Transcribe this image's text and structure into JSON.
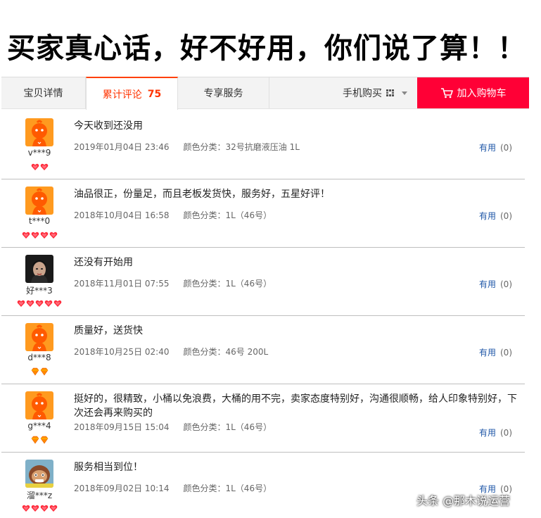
{
  "headline": "买家真心话，好不好用，你们说了算！！",
  "tabs": {
    "detail": "宝贝详情",
    "reviews_label": "累计评论",
    "reviews_count": "75",
    "service": "专享服务",
    "mobile_buy": "手机购买",
    "add_to_cart": "加入购物车"
  },
  "colors": {
    "accent": "#ff0036",
    "tab_active": "#ff3300",
    "link": "#1e56a7"
  },
  "useful_label": "有用",
  "spec_prefix": "颜色分类：",
  "reviews": [
    {
      "user": "v***9",
      "avatar": "tmall-default-avatar",
      "badge_count": 2,
      "badge_type": "red-heart",
      "content": "今天收到还没用",
      "date": "2019年01月04日 23:46",
      "spec": "颜色分类：32号抗磨液压油 1L",
      "useful": "(0)"
    },
    {
      "user": "t***0",
      "avatar": "tmall-default-avatar",
      "badge_count": 4,
      "badge_type": "red-heart",
      "content": "油品很正，份量足，而且老板发货快，服务好，五星好评！",
      "date": "2018年10月04日 16:58",
      "spec": "颜色分类：1L（46号）",
      "useful": "(0)"
    },
    {
      "user": "好***3",
      "avatar": "photo-avatar",
      "badge_count": 5,
      "badge_type": "red-heart",
      "content": "还没有开始用",
      "date": "2018年11月01日 07:55",
      "spec": "颜色分类：1L（46号）",
      "useful": "(0)"
    },
    {
      "user": "d***8",
      "avatar": "tmall-default-avatar",
      "badge_count": 2,
      "badge_type": "diamond",
      "content": "质量好，送货快",
      "date": "2018年10月25日 02:40",
      "spec": "颜色分类：46号 200L",
      "useful": "(0)"
    },
    {
      "user": "g***4",
      "avatar": "tmall-default-avatar",
      "badge_count": 2,
      "badge_type": "diamond",
      "content": "挺好的，很精致，小桶以免浪费，大桶的用不完，卖家态度特别好，沟通很顺畅，给人印象特别好，下次还会再来购买的",
      "date": "2018年09月15日 15:04",
      "spec": "颜色分类：1L（46号）",
      "useful": "(0)"
    },
    {
      "user": "溜***z",
      "avatar": "cartoon-avatar",
      "badge_count": 4,
      "badge_type": "red-heart",
      "content": "服务相当到位！",
      "date": "2018年09月02日 10:14",
      "spec": "颜色分类：1L（46号）",
      "useful": "(0)"
    }
  ],
  "watermark": "头条 @那木说运营"
}
